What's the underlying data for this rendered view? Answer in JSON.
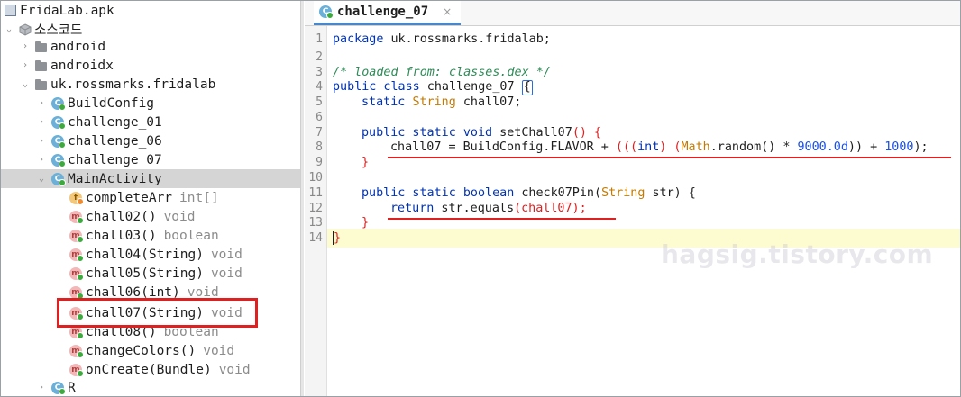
{
  "tree": {
    "nodes": [
      {
        "label": "FridaLab.apk",
        "icon": "apk-icon",
        "arrow": ""
      },
      {
        "label": "소스코드",
        "icon": "source-icon",
        "arrow": "v"
      },
      {
        "label": "android",
        "icon": "package-icon",
        "arrow": ">"
      },
      {
        "label": "androidx",
        "icon": "package-icon",
        "arrow": ">"
      },
      {
        "label": "uk.rossmarks.fridalab",
        "icon": "package-icon",
        "arrow": "v"
      },
      {
        "label": "BuildConfig",
        "icon": "class-icon",
        "arrow": ">"
      },
      {
        "label": "challenge_01",
        "icon": "class-icon",
        "arrow": ">"
      },
      {
        "label": "challenge_06",
        "icon": "class-icon",
        "arrow": ">"
      },
      {
        "label": "challenge_07",
        "icon": "class-icon",
        "arrow": ">"
      },
      {
        "label": "MainActivity",
        "icon": "class-icon",
        "arrow": "v"
      },
      {
        "label": "completeArr",
        "type": "int[]",
        "icon": "field-icon"
      },
      {
        "label": "chall02()",
        "type": "void",
        "icon": "method-icon"
      },
      {
        "label": "chall03()",
        "type": "boolean",
        "icon": "method-icon"
      },
      {
        "label": "chall04(String)",
        "type": "void",
        "icon": "method-icon"
      },
      {
        "label": "chall05(String)",
        "type": "void",
        "icon": "method-icon"
      },
      {
        "label": "chall06(int)",
        "type": "void",
        "icon": "method-icon"
      },
      {
        "label": "chall07(String)",
        "type": "void",
        "icon": "method-icon"
      },
      {
        "label": "chall08()",
        "type": "boolean",
        "icon": "method-icon"
      },
      {
        "label": "changeColors()",
        "type": "void",
        "icon": "method-icon"
      },
      {
        "label": "onCreate(Bundle)",
        "type": "void",
        "icon": "method-icon"
      },
      {
        "label": "R",
        "icon": "class-icon",
        "arrow": ">"
      }
    ],
    "selected": "MainActivity",
    "highlighted": "chall07(String)"
  },
  "editor": {
    "tab_label": "challenge_07",
    "tab_close": "×",
    "line_numbers": [
      "1",
      "2",
      "3",
      "4",
      "5",
      "6",
      "7",
      "8",
      "9",
      "10",
      "11",
      "12",
      "13",
      "14"
    ],
    "lines": {
      "l1a": "package",
      "l1b": " uk.rossmarks.fridalab;",
      "l3": "/* loaded from: classes.dex */",
      "l4a": "public class",
      "l4b": " challenge_07 ",
      "l4c": "{",
      "l5a": "static",
      "l5b": "String",
      "l5c": " chall07;",
      "l7a": "public static void",
      "l7b": " setChall07",
      "l7c": "() {",
      "l8a": "chall07 = BuildConfig.FLAVOR + ",
      "l8b": "(((",
      "l8c": "int",
      "l8d": ") (",
      "l8e": "Math",
      "l8f": ".random() * ",
      "l8g": "9000.0d",
      "l8h": ")) + ",
      "l8i": "1000",
      "l8j": ");",
      "l9": "}",
      "l11a": "public static boolean",
      "l11b": " check07Pin(",
      "l11c": "String",
      "l11d": " str) {",
      "l12a": "return",
      "l12b": " str.equals",
      "l12c": "(chall07);",
      "l13": "}",
      "l14": "}"
    }
  },
  "watermark": "hagsig.tistory.com",
  "colors": {
    "keyword": "#0033b3",
    "type": "#c47a00",
    "comment": "#2e8b57",
    "number": "#1750eb",
    "highlight": "#e02020"
  }
}
